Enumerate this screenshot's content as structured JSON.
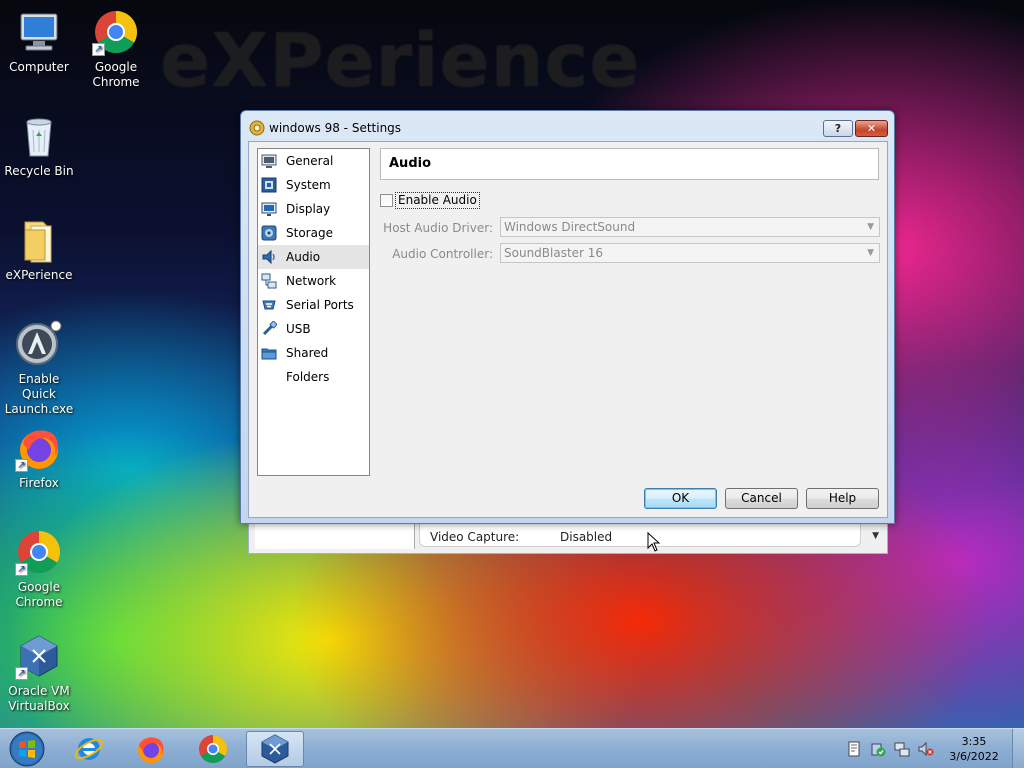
{
  "desktop": {
    "watermark": "eXPerience",
    "icons": [
      {
        "label": "Computer",
        "icon": "computer-icon"
      },
      {
        "label": "Google Chrome",
        "icon": "chrome-icon"
      },
      {
        "label": "Recycle Bin",
        "icon": "recycle-bin-icon"
      },
      {
        "label": "eXPerience",
        "icon": "folder-icon"
      },
      {
        "label": "Enable Quick Launch.exe",
        "icon": "quick-launch-icon"
      },
      {
        "label": "Firefox",
        "icon": "firefox-icon"
      },
      {
        "label": "Google Chrome",
        "icon": "chrome-icon"
      },
      {
        "label": "Oracle VM VirtualBox",
        "icon": "virtualbox-icon"
      }
    ]
  },
  "dialog": {
    "title": "windows 98 - Settings",
    "help_button": "?",
    "close_button": "✕",
    "categories": [
      {
        "label": "General",
        "icon": "general-icon"
      },
      {
        "label": "System",
        "icon": "system-icon"
      },
      {
        "label": "Display",
        "icon": "display-icon"
      },
      {
        "label": "Storage",
        "icon": "storage-icon"
      },
      {
        "label": "Audio",
        "icon": "audio-icon",
        "selected": true
      },
      {
        "label": "Network",
        "icon": "network-icon"
      },
      {
        "label": "Serial Ports",
        "icon": "serial-ports-icon"
      },
      {
        "label": "USB",
        "icon": "usb-icon"
      },
      {
        "label": "Shared Folders",
        "icon": "shared-folders-icon"
      }
    ],
    "section_title": "Audio",
    "enable_audio": {
      "label": "Enable Audio",
      "checked": false
    },
    "host_driver": {
      "label": "Host Audio Driver:",
      "value": "Windows DirectSound"
    },
    "controller": {
      "label": "Audio Controller:",
      "value": "SoundBlaster 16"
    },
    "buttons": {
      "ok": "OK",
      "cancel": "Cancel",
      "help": "Help"
    }
  },
  "parent_window": {
    "detail_key": "Video Capture:",
    "detail_value": "Disabled"
  },
  "taskbar": {
    "pinned": [
      "internet-explorer-icon",
      "firefox-icon",
      "chrome-icon",
      "virtualbox-icon"
    ],
    "clock_time": "3:35",
    "clock_date": "3/6/2022"
  }
}
